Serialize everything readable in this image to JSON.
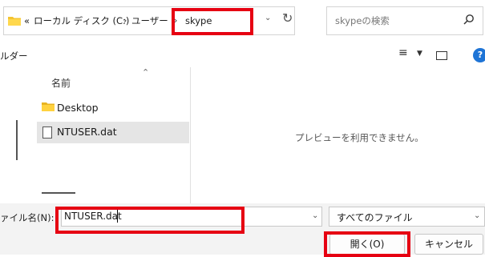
{
  "address": {
    "overflow": "«",
    "crumbs": [
      "ローカル ディスク (C:)",
      "ユーザー",
      "skype"
    ],
    "separator": "›"
  },
  "search": {
    "placeholder": "skypeの検索"
  },
  "toolbar": {
    "folder_label": "ルダー",
    "help": "?"
  },
  "list": {
    "column_name": "名前",
    "items": [
      {
        "label": "Desktop",
        "icon": "folder-icon"
      },
      {
        "label": "NTUSER.dat",
        "icon": "file-icon",
        "selected": true
      }
    ]
  },
  "preview": {
    "message": "プレビューを利用できません。"
  },
  "bottom": {
    "filename_label": "ァイル名(N):",
    "filename_value": "NTUSER.dat",
    "filter_value": "すべてのファイル",
    "open_label": "開く(O)",
    "cancel_label": "キャンセル"
  },
  "colors": {
    "highlight": "#e60012",
    "folder": "#f4c430",
    "accent": "#1e74d6"
  }
}
